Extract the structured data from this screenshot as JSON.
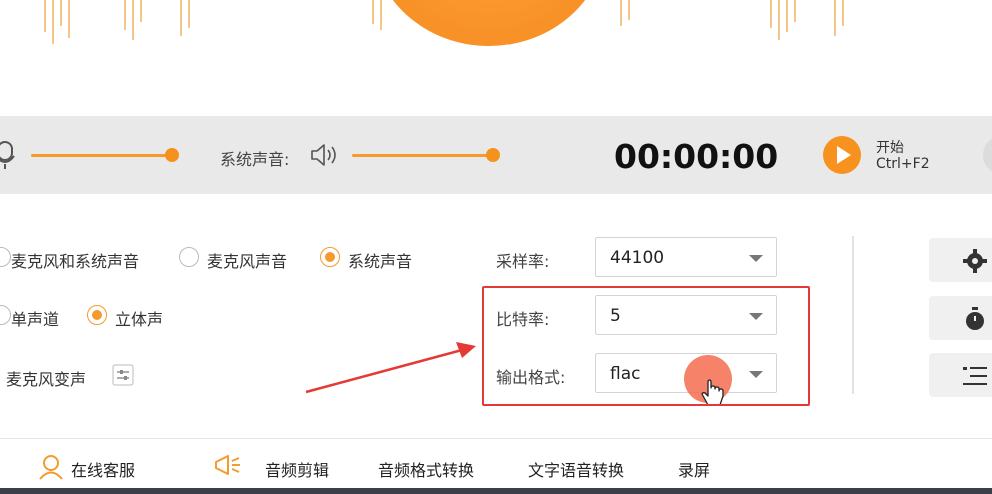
{
  "control_bar": {
    "system_sound_label": "系统声音:",
    "timer": "00:00:00",
    "start_label": "开始",
    "start_shortcut": "Ctrl+F2"
  },
  "sound_source": {
    "options": [
      "麦克风和系统声音",
      "麦克风声音",
      "系统声音"
    ],
    "selected": "系统声音"
  },
  "channel": {
    "options": [
      "单声道",
      "立体声"
    ],
    "selected": "立体声"
  },
  "mic_voice_change_label": "麦克风变声",
  "fields": {
    "sample_rate": {
      "label": "采样率:",
      "value": "44100"
    },
    "bit_rate": {
      "label": "比特率:",
      "value": "5"
    },
    "output_format": {
      "label": "输出格式:",
      "value": "flac"
    }
  },
  "bottom_menu": {
    "online_service": "在线客服",
    "audio_edit": "音频剪辑",
    "audio_format_convert": "音频格式转换",
    "text_to_speech": "文字语音转换",
    "screen_record": "录屏"
  },
  "colors": {
    "accent": "#f59a2e",
    "highlight": "#e53935"
  }
}
